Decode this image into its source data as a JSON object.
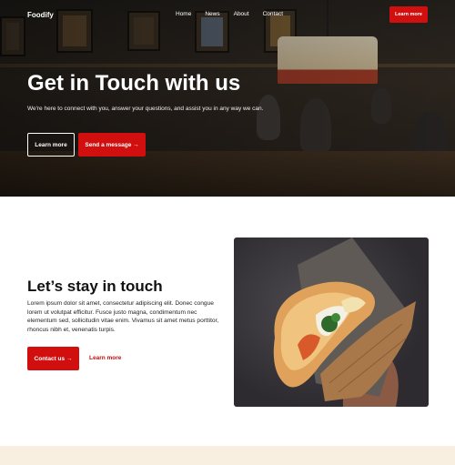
{
  "nav": {
    "brand": "Foodify",
    "links": [
      "Home",
      "News",
      "About",
      "Contact"
    ],
    "cta_label": "Learn more"
  },
  "hero": {
    "title": "Get in Touch with us",
    "subtitle": "We're here to connect with you, answer your questions, and assist you in any way we can.",
    "primary_button": "Learn more",
    "secondary_button": "Send a message →"
  },
  "section": {
    "title": "Let’s stay in touch",
    "body": "Lorem ipsum dolor sit amet, consectetur adipiscing elit. Donec congue lorem ut volutpat efficitur. Fusce justo magna, condimentum nec elementum sed, sollicitudin vitae enim. Vivamus sit amet metus porttitor, rhoncus nibh et, venenatis turpis.",
    "button": "Contact us →",
    "link": "Learn more"
  },
  "colors": {
    "accent": "#d10f0f",
    "bottom_strip": "#f8efe0"
  }
}
